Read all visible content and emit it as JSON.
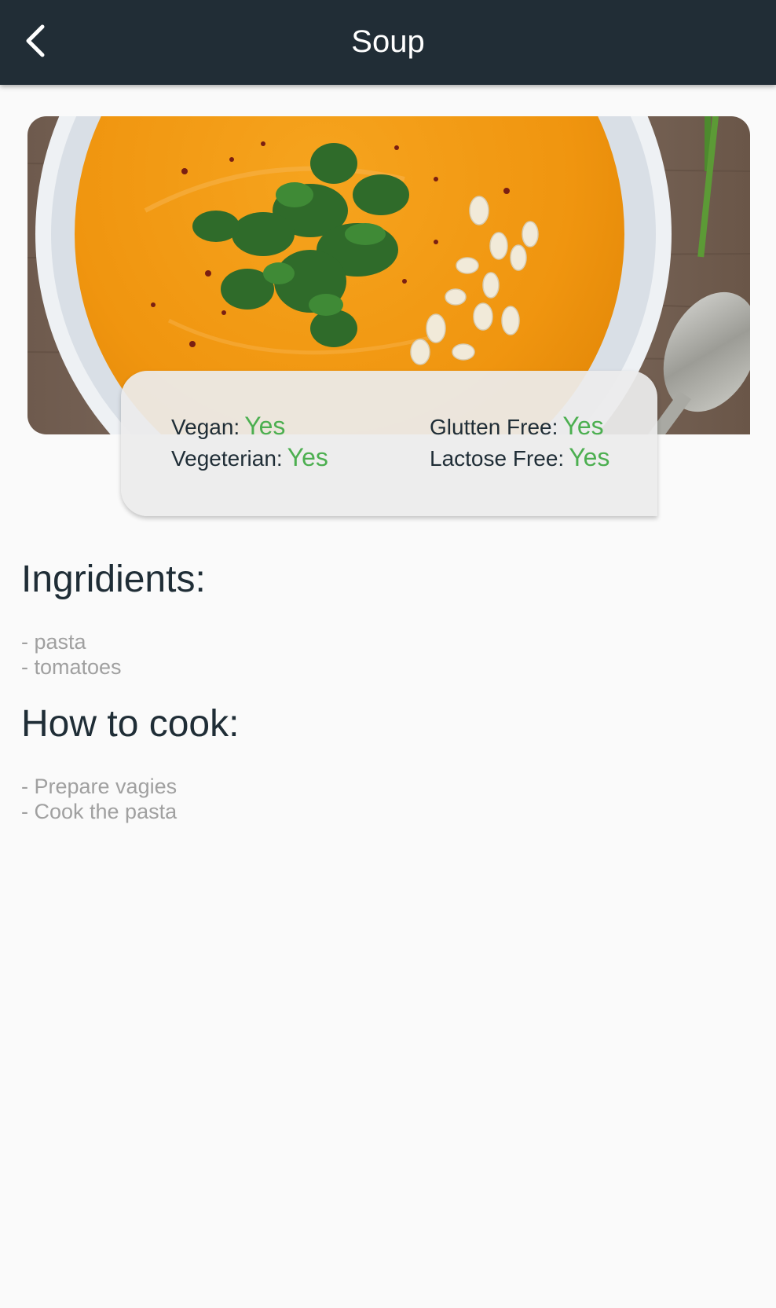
{
  "appbar": {
    "title": "Soup",
    "back_icon": "chevron-left-icon"
  },
  "hero": {
    "image_alt": "Bowl of pumpkin soup with parsley and seeds"
  },
  "diet": {
    "vegan_label": "Vegan:",
    "vegan_value": "Yes",
    "vegetarian_label": "Vegeterian:",
    "vegetarian_value": "Yes",
    "gluten_free_label": "Glutten Free:",
    "gluten_free_value": "Yes",
    "lactose_free_label": "Lactose Free:",
    "lactose_free_value": "Yes"
  },
  "ingredients": {
    "title": "Ingridients:",
    "items": [
      "- pasta",
      "- tomatoes"
    ]
  },
  "instructions": {
    "title": "How to cook:",
    "items": [
      "- Prepare vagies",
      "- Cook the pasta"
    ]
  },
  "colors": {
    "appbar": "#212d36",
    "accent_yes": "#4caf50",
    "heading": "#1f2d36",
    "muted": "#a0a0a0",
    "background": "#fafafa"
  }
}
